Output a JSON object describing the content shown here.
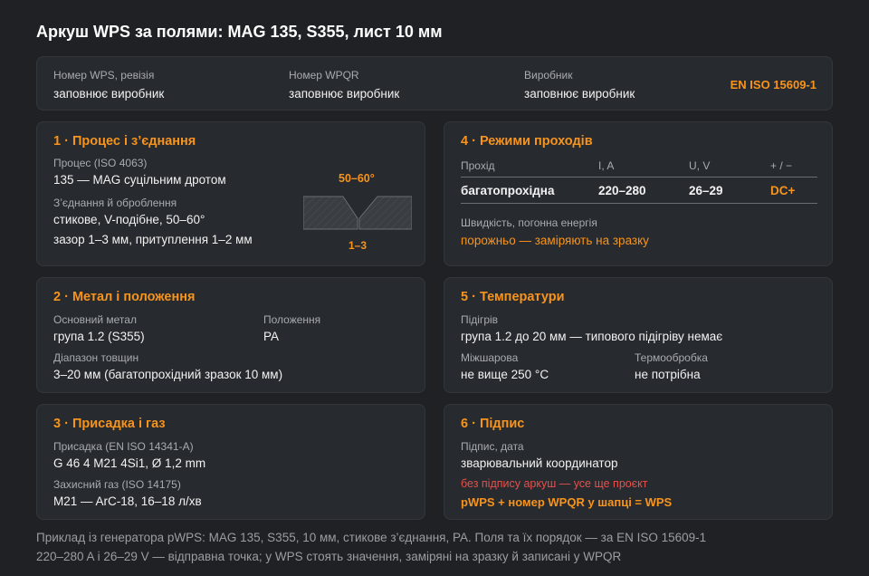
{
  "title": "Аркуш WPS за полями: MAG 135, S355, лист 10 мм",
  "header": {
    "wps_label": "Номер WPS, ревізія",
    "wps_value": "заповнює виробник",
    "wpqr_label": "Номер WPQR",
    "wpqr_value": "заповнює виробник",
    "maker_label": "Виробник",
    "maker_value": "заповнює виробник",
    "standard": "EN ISO 15609-1"
  },
  "process": {
    "heading": "1 · Процес і з’єднання",
    "process_label": "Процес (ISO 4063)",
    "process_value": "135 — MAG суцільним дротом",
    "joint_label": "З’єднання й оброблення",
    "joint_value1": "стикове, V-подібне, 50–60°",
    "joint_value2": "зазор 1–3 мм, притуплення 1–2 мм",
    "angle_label": "50–60°",
    "gap_label": "1–3"
  },
  "passes": {
    "heading": "4 · Режими проходів",
    "col_pass": "Прохід",
    "col_current": "I, A",
    "col_voltage": "U, V",
    "col_polarity": "+ / −",
    "row_pass": "багатопрохідна",
    "row_current": "220–280",
    "row_voltage": "26–29",
    "row_polarity": "DC+",
    "speed_label": "Швидкість, погонна енергія",
    "speed_value": "порожньо — заміряють на зразку"
  },
  "metal": {
    "heading": "2 · Метал і положення",
    "base_label": "Основний метал",
    "base_value": "група 1.2 (S355)",
    "position_label": "Положення",
    "position_value": "PA",
    "thickness_label": "Діапазон товщин",
    "thickness_value": "3–20 мм (багатопрохідний зразок 10 мм)"
  },
  "temps": {
    "heading": "5 · Температури",
    "preheat_label": "Підігрів",
    "preheat_value": "група 1.2 до 20 мм — типового підігріву немає",
    "interpass_label": "Міжшарова",
    "interpass_value": "не вище 250 °C",
    "pwht_label": "Термообробка",
    "pwht_value": "не потрібна"
  },
  "filler": {
    "heading": "3 · Присадка і газ",
    "filler_label": "Присадка (EN ISO 14341-A)",
    "filler_value": "G 46 4 M21 4Si1, Ø 1,2 mm",
    "gas_label": "Захисний газ (ISO 14175)",
    "gas_value": "M21 — ArC-18, 16–18 л/хв"
  },
  "signature": {
    "heading": "6 · Підпис",
    "sign_label": "Підпис, дата",
    "sign_value": "зварювальний координатор",
    "warning": "без підпису аркуш — усе ще проєкт",
    "formula": "pWPS + номер WPQR у шапці = WPS"
  },
  "footer": {
    "line1": "Приклад із генератора pWPS: MAG 135, S355, 10 мм, стикове з’єднання, PA. Поля та їх порядок — за EN ISO 15609-1",
    "line2": "220–280 A і 26–29 V — відправна точка; у WPS стоять значення, заміряні на зразку й записані у WPQR"
  },
  "colors": {
    "accent": "#f7941d",
    "warning": "#e8504a",
    "background": "#1f2124",
    "card": "#272a2e"
  }
}
